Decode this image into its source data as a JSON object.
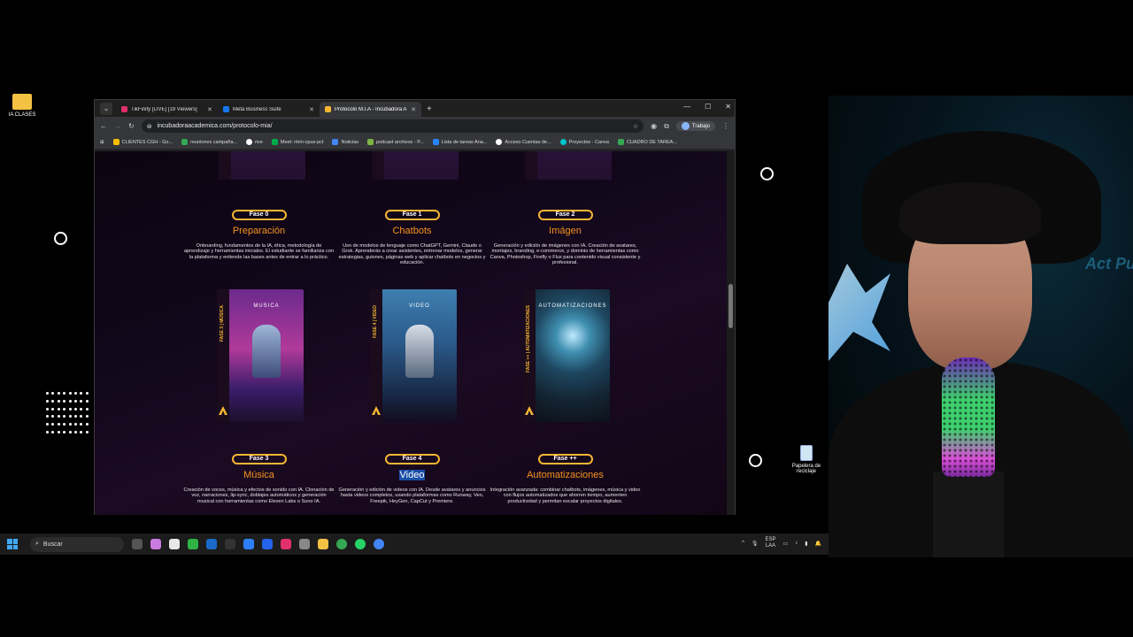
{
  "desktop": {
    "folder_label": "IA CLASES",
    "recycle_label": "Papelera de reciclaje"
  },
  "browser": {
    "tabs": [
      {
        "title": "TikFinity [LIVE] [19 Viewers]",
        "color": "#e1306c"
      },
      {
        "title": "Meta Business Suite",
        "color": "#1877f2"
      },
      {
        "title": "Protocolo M.I.A - Incubadora A",
        "color": "#f7b733"
      }
    ],
    "url": "incubadoraacademica.com/protocolo-mia/",
    "profile": "Trabajo",
    "bookmarks": [
      {
        "label": "CLIENTES CGH - Go...",
        "color": "#fbbc04"
      },
      {
        "label": "reuniones campaña...",
        "color": "#34a853"
      },
      {
        "label": "rive",
        "color": "#ffffff"
      },
      {
        "label": "Meet: nhm-cpus-pct",
        "color": "#00ac47"
      },
      {
        "label": "Noticias",
        "color": "#4285f4"
      },
      {
        "label": "podcast archivos - P...",
        "color": "#7cb342"
      },
      {
        "label": "Lista de tareas Ana...",
        "color": "#2684fc"
      },
      {
        "label": "Acceso Cuentas de...",
        "color": "#ffffff"
      },
      {
        "label": "Proyectos - Canva",
        "color": "#00c4cc"
      },
      {
        "label": "CUADRO DE TAREA...",
        "color": "#34a853"
      }
    ]
  },
  "phases": [
    {
      "badge": "Fase 0",
      "title": "Preparación",
      "desc": "Onboarding, fundamentos de la IA, ética, metodología de aprendizaje y herramientas iniciales. El estudiante se familiariza con la plataforma y entiende las bases antes de entrar a lo práctico."
    },
    {
      "badge": "Fase 1",
      "title": "Chatbots",
      "desc": "Uso de modelos de lenguaje como ChatGPT, Gemini, Claude o Grok. Aprenderás a crear asistentes, entrenar modelos, generar estrategias, guiones, páginas web y aplicar chatbots en negocios y educación."
    },
    {
      "badge": "Fase 2",
      "title": "Imágen",
      "desc": "Generación y edición de imágenes con IA. Creación de avatares, montajes, branding, e-commerce, y dominio de herramientas como Canva, Photoshop, Firefly o Flux para contenido visual consistente y profesional."
    },
    {
      "badge": "Fase 3",
      "title": "Música",
      "desc": "Creación de voces, música y efectos de sonido con IA. Clonación de voz, narraciones, lip-sync, doblajes automáticos y generación musical con herramientas como Eleven Labs o Suno IA.",
      "box_title": "MUSICA",
      "box_spine": "FASE 3 | MÚSICA"
    },
    {
      "badge": "Fase 4",
      "title": "Video",
      "desc": "Generación y edición de videos con IA. Desde avatares y anuncios hasta videos completos, usando plataformas como Runway, Veo, Freepik, HeyGen, CapCut y Premiere.",
      "box_title": "VIDEO",
      "box_spine": "FASE 4 | VIDEO"
    },
    {
      "badge": "Fase ++",
      "title": "Automatizaciones",
      "desc": "Integración avanzada: combinar chatbots, imágenes, música y video con flujos automatizados que ahorren tiempo, aumenten productividad y permitan escalar proyectos digitales.",
      "box_title": "AUTOMATIZACIONES",
      "box_spine": "FASE ++ | AUTOMATIZACIONES"
    }
  ],
  "taskbar": {
    "search_placeholder": "Buscar",
    "lang_top": "ESP",
    "lang_bottom": "LAA"
  },
  "webcam": {
    "wall_text": "Act Pu"
  }
}
